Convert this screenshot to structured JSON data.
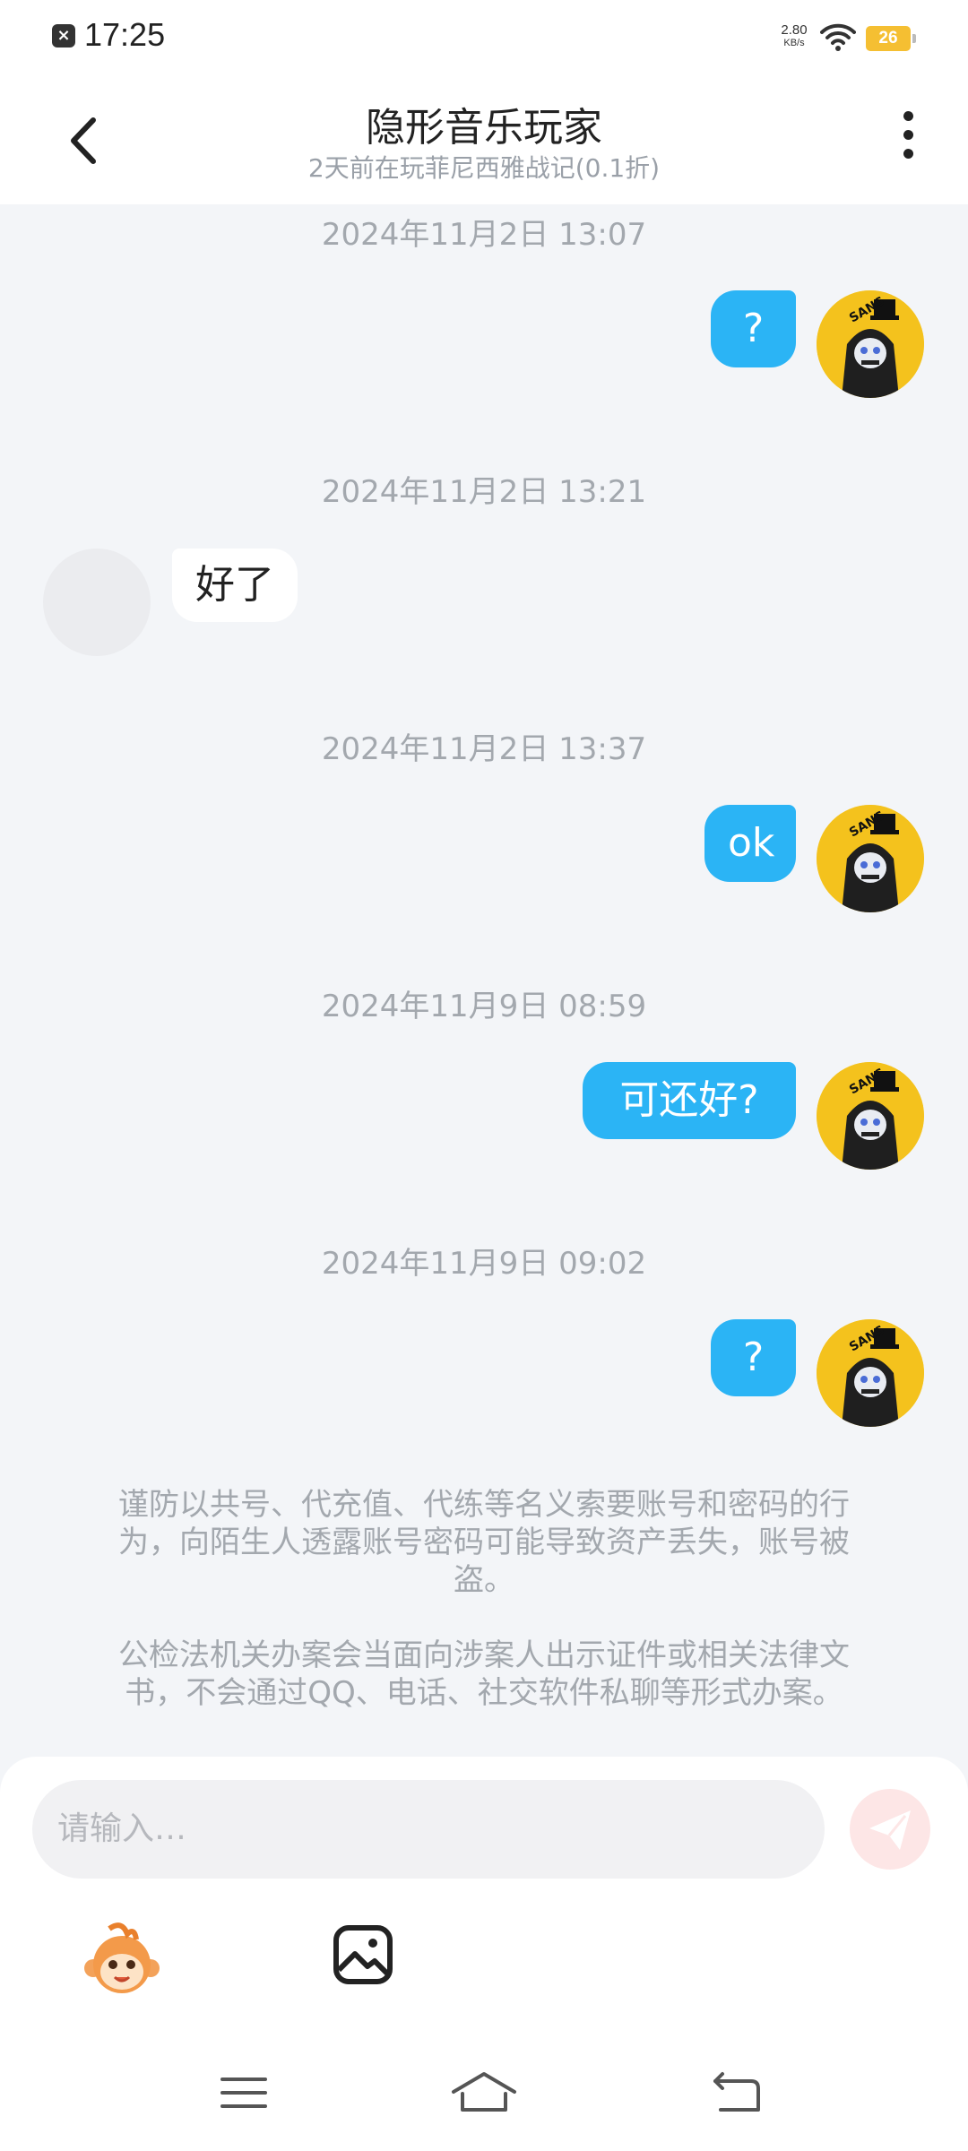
{
  "status_bar": {
    "time": "17:25",
    "net_speed_value": "2.80",
    "net_speed_unit": "KB/s",
    "battery": "26",
    "battery_color": "#f5bf32"
  },
  "header": {
    "title": "隐形音乐玩家",
    "subtitle": "2天前在玩菲尼西雅战记(0.1折)"
  },
  "messages": [
    {
      "timestamp": "2024年11月2日 13:07",
      "sender": "me",
      "text": "?"
    },
    {
      "timestamp": "2024年11月2日 13:21",
      "sender": "other",
      "text": "好了"
    },
    {
      "timestamp": "2024年11月2日 13:37",
      "sender": "me",
      "text": "ok"
    },
    {
      "timestamp": "2024年11月9日 08:59",
      "sender": "me",
      "text": "可还好?"
    },
    {
      "timestamp": "2024年11月9日 09:02",
      "sender": "me",
      "text": "?"
    }
  ],
  "warnings": [
    "谨防以共号、代充值、代练等名义索要账号和密码的行为，向陌生人透露账号密码可能导致资产丢失，账号被盗。",
    "公检法机关办案会当面向涉案人出示证件或相关法律文书，不会通过QQ、电话、社交软件私聊等形式办案。"
  ],
  "input": {
    "placeholder": "请输入…"
  },
  "colors": {
    "my_bubble": "#2bb4f5",
    "background": "#f3f5f8",
    "send_button": "#fde6e6"
  },
  "icons": {
    "back": "chevron-left-icon",
    "more": "more-vertical-icon",
    "emoji": "monkey-emoji-icon",
    "image": "image-icon",
    "send": "send-icon",
    "nav_menu": "menu-icon",
    "nav_home": "home-icon",
    "nav_back": "back-icon"
  }
}
